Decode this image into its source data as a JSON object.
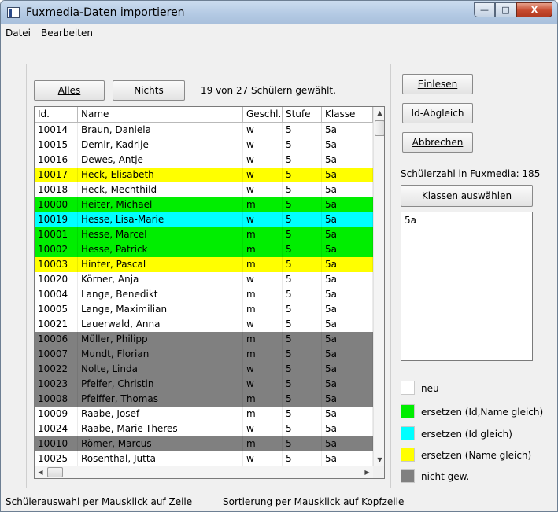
{
  "window": {
    "title": "Fuxmedia-Daten importieren",
    "minimize_glyph": "—",
    "maximize_glyph": "□",
    "close_glyph": "X"
  },
  "menu": {
    "items": [
      "Datei",
      "Bearbeiten"
    ]
  },
  "selection": {
    "all_label": "Alles",
    "none_label": "Nichts",
    "count_text": "19 von 27 Schülern gewählt."
  },
  "list": {
    "columns": [
      "Id.",
      "Name",
      "Geschl.",
      "Stufe",
      "Klasse"
    ],
    "rows": [
      {
        "id": "10014",
        "name": "Braun, Daniela",
        "g": "w",
        "s": "5",
        "k": "5a",
        "status": "new"
      },
      {
        "id": "10015",
        "name": "Demir, Kadrije",
        "g": "w",
        "s": "5",
        "k": "5a",
        "status": "new"
      },
      {
        "id": "10016",
        "name": "Dewes, Antje",
        "g": "w",
        "s": "5",
        "k": "5a",
        "status": "new"
      },
      {
        "id": "10017",
        "name": "Heck, Elisabeth",
        "g": "w",
        "s": "5",
        "k": "5a",
        "status": "replace-name"
      },
      {
        "id": "10018",
        "name": "Heck, Mechthild",
        "g": "w",
        "s": "5",
        "k": "5a",
        "status": "new"
      },
      {
        "id": "10000",
        "name": "Heiter, Michael",
        "g": "m",
        "s": "5",
        "k": "5a",
        "status": "replace-id-name"
      },
      {
        "id": "10019",
        "name": "Hesse, Lisa-Marie",
        "g": "w",
        "s": "5",
        "k": "5a",
        "status": "replace-id"
      },
      {
        "id": "10001",
        "name": "Hesse, Marcel",
        "g": "m",
        "s": "5",
        "k": "5a",
        "status": "replace-id-name"
      },
      {
        "id": "10002",
        "name": "Hesse, Patrick",
        "g": "m",
        "s": "5",
        "k": "5a",
        "status": "replace-id-name"
      },
      {
        "id": "10003",
        "name": "Hinter, Pascal",
        "g": "m",
        "s": "5",
        "k": "5a",
        "status": "replace-name"
      },
      {
        "id": "10020",
        "name": "Körner, Anja",
        "g": "w",
        "s": "5",
        "k": "5a",
        "status": "new"
      },
      {
        "id": "10004",
        "name": "Lange, Benedikt",
        "g": "m",
        "s": "5",
        "k": "5a",
        "status": "new"
      },
      {
        "id": "10005",
        "name": "Lange, Maximilian",
        "g": "m",
        "s": "5",
        "k": "5a",
        "status": "new"
      },
      {
        "id": "10021",
        "name": "Lauerwald, Anna",
        "g": "w",
        "s": "5",
        "k": "5a",
        "status": "new"
      },
      {
        "id": "10006",
        "name": "Müller, Philipp",
        "g": "m",
        "s": "5",
        "k": "5a",
        "status": "not-selected"
      },
      {
        "id": "10007",
        "name": "Mundt, Florian",
        "g": "m",
        "s": "5",
        "k": "5a",
        "status": "not-selected"
      },
      {
        "id": "10022",
        "name": "Nolte, Linda",
        "g": "w",
        "s": "5",
        "k": "5a",
        "status": "not-selected"
      },
      {
        "id": "10023",
        "name": "Pfeifer, Christin",
        "g": "w",
        "s": "5",
        "k": "5a",
        "status": "not-selected"
      },
      {
        "id": "10008",
        "name": "Pfeiffer, Thomas",
        "g": "m",
        "s": "5",
        "k": "5a",
        "status": "not-selected"
      },
      {
        "id": "10009",
        "name": "Raabe, Josef",
        "g": "m",
        "s": "5",
        "k": "5a",
        "status": "new"
      },
      {
        "id": "10024",
        "name": "Raabe, Marie-Theres",
        "g": "w",
        "s": "5",
        "k": "5a",
        "status": "new"
      },
      {
        "id": "10010",
        "name": "Römer, Marcus",
        "g": "m",
        "s": "5",
        "k": "5a",
        "status": "not-selected"
      },
      {
        "id": "10025",
        "name": "Rosenthal, Jutta",
        "g": "w",
        "s": "5",
        "k": "5a",
        "status": "new"
      }
    ]
  },
  "actions": {
    "read_label": "Einlesen",
    "id_match_label": "Id-Abgleich",
    "cancel_label": "Abbrechen",
    "count_text": "Schülerzahl in Fuxmedia: 185",
    "choose_classes_label": "Klassen auswählen",
    "classes": [
      "5a"
    ]
  },
  "legend": [
    {
      "label": "neu",
      "color": "#ffffff",
      "status": "new"
    },
    {
      "label": "ersetzen (Id,Name gleich)",
      "color": "#00ee00",
      "status": "replace-id-name"
    },
    {
      "label": "ersetzen (Id gleich)",
      "color": "#00ffff",
      "status": "replace-id"
    },
    {
      "label": "ersetzen (Name gleich)",
      "color": "#ffff00",
      "status": "replace-name"
    },
    {
      "label": "nicht gew.",
      "color": "#808080",
      "status": "not-selected"
    }
  ],
  "status": {
    "left": "Schülerauswahl per Mausklick auf Zeile",
    "right": "Sortierung per Mausklick auf Kopfzeile"
  }
}
